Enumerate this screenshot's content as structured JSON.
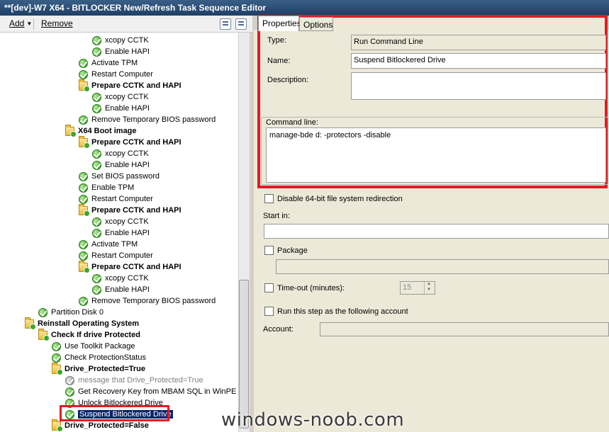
{
  "window": {
    "title": "**[dev]-W7 X64 - BITLOCKER New/Refresh Task Sequence Editor"
  },
  "toolbar": {
    "add_label": "Add",
    "remove_label": "Remove"
  },
  "tree": [
    {
      "label": "xcopy CCTK",
      "kind": "step"
    },
    {
      "label": "Enable HAPI",
      "kind": "step"
    },
    {
      "label": "Activate TPM",
      "kind": "step"
    },
    {
      "label": "Restart Computer",
      "kind": "step"
    },
    {
      "label": "Prepare CCTK and HAPI",
      "kind": "group"
    },
    {
      "label": "xcopy CCTK",
      "kind": "step"
    },
    {
      "label": "Enable HAPI",
      "kind": "step"
    },
    {
      "label": "Remove Temporary BIOS password",
      "kind": "step"
    },
    {
      "label": "X64 Boot image",
      "kind": "group"
    },
    {
      "label": "Prepare CCTK and HAPI",
      "kind": "group"
    },
    {
      "label": "xcopy CCTK",
      "kind": "step"
    },
    {
      "label": "Enable HAPI",
      "kind": "step"
    },
    {
      "label": "Set BIOS password",
      "kind": "step"
    },
    {
      "label": "Enable TPM",
      "kind": "step"
    },
    {
      "label": "Restart Computer",
      "kind": "step"
    },
    {
      "label": "Prepare CCTK and HAPI",
      "kind": "group"
    },
    {
      "label": "xcopy CCTK",
      "kind": "step"
    },
    {
      "label": "Enable HAPI",
      "kind": "step"
    },
    {
      "label": "Activate TPM",
      "kind": "step"
    },
    {
      "label": "Restart Computer",
      "kind": "step"
    },
    {
      "label": "Prepare CCTK and HAPI",
      "kind": "group"
    },
    {
      "label": "xcopy CCTK",
      "kind": "step"
    },
    {
      "label": "Enable HAPI",
      "kind": "step"
    },
    {
      "label": "Remove Temporary BIOS password",
      "kind": "step"
    },
    {
      "label": "Partition Disk 0",
      "kind": "step"
    },
    {
      "label": "Reinstall Operating System",
      "kind": "group"
    },
    {
      "label": "Check If drive Protected",
      "kind": "group"
    },
    {
      "label": "Use Toolkit Package",
      "kind": "step"
    },
    {
      "label": "Check ProtectionStatus",
      "kind": "step"
    },
    {
      "label": "Drive_Protected=True",
      "kind": "group"
    },
    {
      "label": "message that Drive_Protected=True",
      "kind": "disabled"
    },
    {
      "label": "Get Recovery Key from MBAM SQL in WinPE",
      "kind": "step"
    },
    {
      "label": "Unlock Bitlockered Drive",
      "kind": "step"
    },
    {
      "label": "Suspend Bitlockered Drive",
      "kind": "selected"
    },
    {
      "label": "Drive_Protected=False",
      "kind": "group"
    }
  ],
  "tabs": [
    "Properties",
    "Options"
  ],
  "properties": {
    "type_label": "Type:",
    "type_value": "Run Command Line",
    "name_label": "Name:",
    "name_value": "Suspend Bitlockered Drive",
    "description_label": "Description:",
    "description_value": "",
    "command_line_label": "Command line:",
    "command_line_value": "manage-bde d: -protectors -disable",
    "disable64_label": "Disable 64-bit file system redirection",
    "start_in_label": "Start in:",
    "start_in_value": "",
    "package_label": "Package",
    "package_value": "",
    "timeout_label": "Time-out (minutes):",
    "timeout_value": "15",
    "runas_label": "Run this step as the following account",
    "account_label": "Account:",
    "account_value": ""
  },
  "watermark": "windows-noob.com",
  "colors": {
    "highlight": "#e21b24",
    "selection": "#0a246a"
  }
}
